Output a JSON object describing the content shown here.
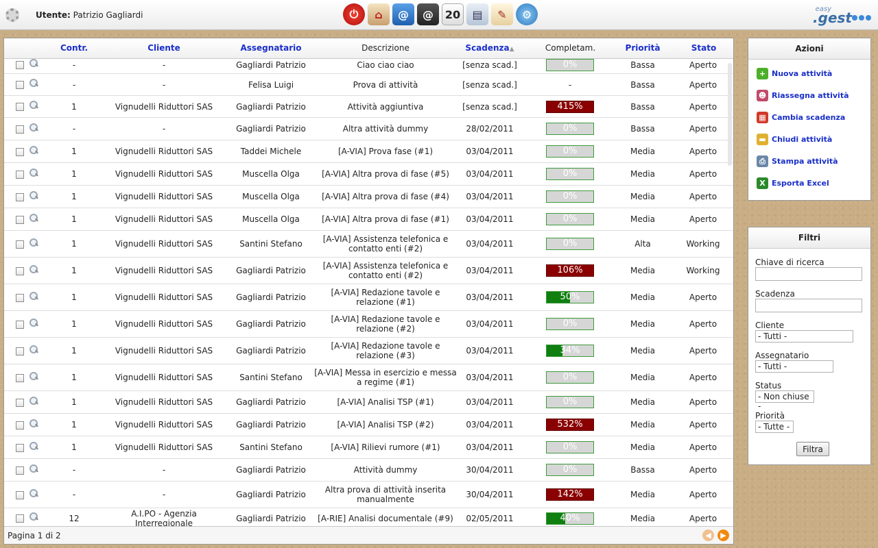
{
  "header": {
    "user_label": "Utente:",
    "user_name": "Patrizio Gagliardi",
    "toolbar": [
      {
        "icon": "power-icon",
        "glyph": "⏻"
      },
      {
        "icon": "home-icon",
        "glyph": "⌂"
      },
      {
        "icon": "mail-icon",
        "glyph": "@"
      },
      {
        "icon": "address-book-icon",
        "glyph": "@"
      },
      {
        "icon": "calendar-icon",
        "glyph": "20"
      },
      {
        "icon": "documents-icon",
        "glyph": "▤"
      },
      {
        "icon": "notes-icon",
        "glyph": "✎"
      },
      {
        "icon": "settings-icon",
        "glyph": "⚙"
      }
    ],
    "logo_small": "easy",
    "logo_main": ".gest"
  },
  "table": {
    "columns": {
      "contr": "Contr.",
      "cliente": "Cliente",
      "assegnatario": "Assegnatario",
      "descrizione": "Descrizione",
      "scadenza": "Scadenza",
      "completam": "Completam.",
      "priorita": "Priorità",
      "stato": "Stato"
    },
    "rows": [
      {
        "contr": "-",
        "cliente": "-",
        "assegnatario": "Gagliardi Patrizio",
        "descrizione": "Ciao ciao ciao",
        "scadenza": "[senza scad.]",
        "completamento": 0,
        "completamento_label": "0%",
        "priorita": "Bassa",
        "stato": "Aperto"
      },
      {
        "contr": "-",
        "cliente": "-",
        "assegnatario": "Felisa Luigi",
        "descrizione": "Prova di attività",
        "scadenza": "[senza scad.]",
        "completamento": null,
        "completamento_label": "-",
        "priorita": "Bassa",
        "stato": "Aperto"
      },
      {
        "contr": "1",
        "cliente": "Vignudelli Riduttori SAS",
        "assegnatario": "Gagliardi Patrizio",
        "descrizione": "Attività aggiuntiva",
        "scadenza": "[senza scad.]",
        "completamento": 415,
        "completamento_label": "415%",
        "priorita": "Bassa",
        "stato": "Aperto"
      },
      {
        "contr": "-",
        "cliente": "-",
        "assegnatario": "Gagliardi Patrizio",
        "descrizione": "Altra attività dummy",
        "scadenza": "28/02/2011",
        "completamento": 0,
        "completamento_label": "0%",
        "priorita": "Bassa",
        "stato": "Aperto"
      },
      {
        "contr": "1",
        "cliente": "Vignudelli Riduttori SAS",
        "assegnatario": "Taddei Michele",
        "descrizione": "[A-VIA] Prova fase (#1)",
        "scadenza": "03/04/2011",
        "completamento": 0,
        "completamento_label": "0%",
        "priorita": "Media",
        "stato": "Aperto"
      },
      {
        "contr": "1",
        "cliente": "Vignudelli Riduttori SAS",
        "assegnatario": "Muscella Olga",
        "descrizione": "[A-VIA] Altra prova di fase (#5)",
        "scadenza": "03/04/2011",
        "completamento": 0,
        "completamento_label": "0%",
        "priorita": "Media",
        "stato": "Aperto"
      },
      {
        "contr": "1",
        "cliente": "Vignudelli Riduttori SAS",
        "assegnatario": "Muscella Olga",
        "descrizione": "[A-VIA] Altra prova di fase (#4)",
        "scadenza": "03/04/2011",
        "completamento": 0,
        "completamento_label": "0%",
        "priorita": "Media",
        "stato": "Aperto"
      },
      {
        "contr": "1",
        "cliente": "Vignudelli Riduttori SAS",
        "assegnatario": "Muscella Olga",
        "descrizione": "[A-VIA] Altra prova di fase (#1)",
        "scadenza": "03/04/2011",
        "completamento": 0,
        "completamento_label": "0%",
        "priorita": "Media",
        "stato": "Aperto"
      },
      {
        "contr": "1",
        "cliente": "Vignudelli Riduttori SAS",
        "assegnatario": "Santini Stefano",
        "descrizione": "[A-VIA] Assistenza telefonica e contatto enti (#2)",
        "scadenza": "03/04/2011",
        "completamento": 0,
        "completamento_label": "0%",
        "priorita": "Alta",
        "stato": "Working"
      },
      {
        "contr": "1",
        "cliente": "Vignudelli Riduttori SAS",
        "assegnatario": "Gagliardi Patrizio",
        "descrizione": "[A-VIA] Assistenza telefonica e contatto enti (#2)",
        "scadenza": "03/04/2011",
        "completamento": 106,
        "completamento_label": "106%",
        "priorita": "Media",
        "stato": "Working"
      },
      {
        "contr": "1",
        "cliente": "Vignudelli Riduttori SAS",
        "assegnatario": "Gagliardi Patrizio",
        "descrizione": "[A-VIA] Redazione tavole e relazione (#1)",
        "scadenza": "03/04/2011",
        "completamento": 50,
        "completamento_label": "50%",
        "priorita": "Media",
        "stato": "Aperto"
      },
      {
        "contr": "1",
        "cliente": "Vignudelli Riduttori SAS",
        "assegnatario": "Gagliardi Patrizio",
        "descrizione": "[A-VIA] Redazione tavole e relazione (#2)",
        "scadenza": "03/04/2011",
        "completamento": 0,
        "completamento_label": "0%",
        "priorita": "Media",
        "stato": "Aperto"
      },
      {
        "contr": "1",
        "cliente": "Vignudelli Riduttori SAS",
        "assegnatario": "Gagliardi Patrizio",
        "descrizione": "[A-VIA] Redazione tavole e relazione (#3)",
        "scadenza": "03/04/2011",
        "completamento": 34,
        "completamento_label": "34%",
        "priorita": "Media",
        "stato": "Aperto"
      },
      {
        "contr": "1",
        "cliente": "Vignudelli Riduttori SAS",
        "assegnatario": "Santini Stefano",
        "descrizione": "[A-VIA] Messa in esercizio e messa a regime (#1)",
        "scadenza": "03/04/2011",
        "completamento": 0,
        "completamento_label": "0%",
        "priorita": "Media",
        "stato": "Aperto"
      },
      {
        "contr": "1",
        "cliente": "Vignudelli Riduttori SAS",
        "assegnatario": "Gagliardi Patrizio",
        "descrizione": "[A-VIA] Analisi TSP (#1)",
        "scadenza": "03/04/2011",
        "completamento": 0,
        "completamento_label": "0%",
        "priorita": "Media",
        "stato": "Aperto"
      },
      {
        "contr": "1",
        "cliente": "Vignudelli Riduttori SAS",
        "assegnatario": "Gagliardi Patrizio",
        "descrizione": "[A-VIA] Analisi TSP (#2)",
        "scadenza": "03/04/2011",
        "completamento": 532,
        "completamento_label": "532%",
        "priorita": "Media",
        "stato": "Aperto"
      },
      {
        "contr": "1",
        "cliente": "Vignudelli Riduttori SAS",
        "assegnatario": "Santini Stefano",
        "descrizione": "[A-VIA] Rilievi rumore (#1)",
        "scadenza": "03/04/2011",
        "completamento": 0,
        "completamento_label": "0%",
        "priorita": "Media",
        "stato": "Aperto"
      },
      {
        "contr": "-",
        "cliente": "-",
        "assegnatario": "Gagliardi Patrizio",
        "descrizione": "Attività dummy",
        "scadenza": "30/04/2011",
        "completamento": 0,
        "completamento_label": "0%",
        "priorita": "Bassa",
        "stato": "Aperto"
      },
      {
        "contr": "-",
        "cliente": "-",
        "assegnatario": "Gagliardi Patrizio",
        "descrizione": "Altra prova di attività inserita manualmente",
        "scadenza": "30/04/2011",
        "completamento": 142,
        "completamento_label": "142%",
        "priorita": "Media",
        "stato": "Aperto"
      },
      {
        "contr": "12",
        "cliente": "A.I.PO - Agenzia Interregionale",
        "assegnatario": "Gagliardi Patrizio",
        "descrizione": "[A-RIE] Analisi documentale (#9)",
        "scadenza": "02/05/2011",
        "completamento": 40,
        "completamento_label": "40%",
        "priorita": "Media",
        "stato": "Aperto"
      }
    ],
    "footer": {
      "page_label": "Pagina 1 di 2"
    }
  },
  "actions": {
    "title": "Azioni",
    "items": [
      {
        "label": "Nuova attività",
        "icon": "add-icon",
        "color": "#4caf2a",
        "glyph": "+"
      },
      {
        "label": "Riassegna attività",
        "icon": "users-icon",
        "color": "#c04a6a",
        "glyph": "☻"
      },
      {
        "label": "Cambia scadenza",
        "icon": "calendar-icon",
        "color": "#d03a2a",
        "glyph": "▦"
      },
      {
        "label": "Chiudi attività",
        "icon": "folder-icon",
        "color": "#e0b030",
        "glyph": "▬"
      },
      {
        "label": "Stampa attività",
        "icon": "printer-icon",
        "color": "#6a88a8",
        "glyph": "⎙"
      },
      {
        "label": "Esporta Excel",
        "icon": "excel-icon",
        "color": "#2a8a2a",
        "glyph": "X"
      }
    ]
  },
  "filters": {
    "title": "Filtri",
    "search_label": "Chiave di ricerca",
    "search_value": "",
    "deadline_label": "Scadenza",
    "deadline_value": "",
    "client_label": "Cliente",
    "client_value": "- Tutti -",
    "assignee_label": "Assegnatario",
    "assignee_value": "- Tutti -",
    "status_label": "Status",
    "status_value": "- Non chiuse -",
    "priority_label": "Priorità",
    "priority_value": "- Tutte -",
    "submit_label": "Filtra"
  },
  "colors": {
    "sort_header": "#1a2fc8",
    "progress_ok": "#0f7f0f",
    "progress_over": "#8a0000",
    "action_link": "#1a2fc8"
  }
}
